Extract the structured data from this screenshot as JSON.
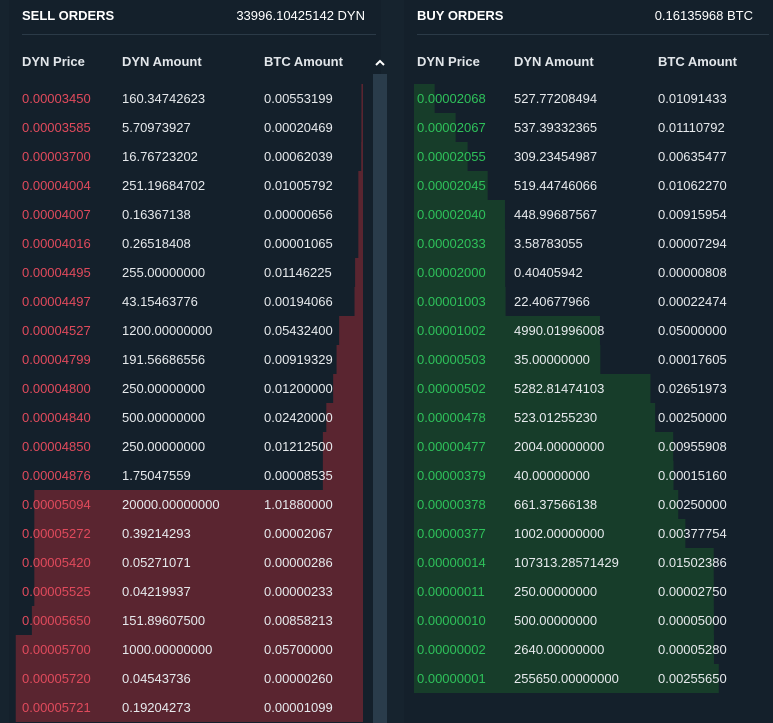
{
  "colors": {
    "sell_price": "#e04a5c",
    "buy_price": "#2ec15a",
    "sell_depth_fill": "#5a2530",
    "buy_depth_fill": "#173d2a"
  },
  "sell": {
    "title": "SELL ORDERS",
    "total": "33996.10425142 DYN",
    "headers": [
      "DYN Price",
      "DYN Amount",
      "BTC Amount"
    ],
    "scroll_icon": "chevron-up-icon",
    "rows": [
      {
        "price": "0.00003450",
        "dyn": "160.34742623",
        "btc": "0.00553199"
      },
      {
        "price": "0.00003585",
        "dyn": "5.70973927",
        "btc": "0.00020469"
      },
      {
        "price": "0.00003700",
        "dyn": "16.76723202",
        "btc": "0.00062039"
      },
      {
        "price": "0.00004004",
        "dyn": "251.19684702",
        "btc": "0.01005792"
      },
      {
        "price": "0.00004007",
        "dyn": "0.16367138",
        "btc": "0.00000656"
      },
      {
        "price": "0.00004016",
        "dyn": "0.26518408",
        "btc": "0.00001065"
      },
      {
        "price": "0.00004495",
        "dyn": "255.00000000",
        "btc": "0.01146225"
      },
      {
        "price": "0.00004497",
        "dyn": "43.15463776",
        "btc": "0.00194066"
      },
      {
        "price": "0.00004527",
        "dyn": "1200.00000000",
        "btc": "0.05432400"
      },
      {
        "price": "0.00004799",
        "dyn": "191.56686556",
        "btc": "0.00919329"
      },
      {
        "price": "0.00004800",
        "dyn": "250.00000000",
        "btc": "0.01200000"
      },
      {
        "price": "0.00004840",
        "dyn": "500.00000000",
        "btc": "0.02420000"
      },
      {
        "price": "0.00004850",
        "dyn": "250.00000000",
        "btc": "0.01212500"
      },
      {
        "price": "0.00004876",
        "dyn": "1.75047559",
        "btc": "0.00008535"
      },
      {
        "price": "0.00005094",
        "dyn": "20000.00000000",
        "btc": "1.01880000"
      },
      {
        "price": "0.00005272",
        "dyn": "0.39214293",
        "btc": "0.00002067"
      },
      {
        "price": "0.00005420",
        "dyn": "0.05271071",
        "btc": "0.00000286"
      },
      {
        "price": "0.00005525",
        "dyn": "0.04219937",
        "btc": "0.00000233"
      },
      {
        "price": "0.00005650",
        "dyn": "151.89607500",
        "btc": "0.00858213"
      },
      {
        "price": "0.00005700",
        "dyn": "1000.00000000",
        "btc": "0.05700000"
      },
      {
        "price": "0.00005720",
        "dyn": "0.04543736",
        "btc": "0.00000260"
      },
      {
        "price": "0.00005721",
        "dyn": "0.19204273",
        "btc": "0.00001099"
      }
    ]
  },
  "buy": {
    "title": "BUY ORDERS",
    "total": "0.16135968 BTC",
    "headers": [
      "DYN Price",
      "DYN Amount",
      "BTC Amount"
    ],
    "rows": [
      {
        "price": "0.00002068",
        "dyn": "527.77208494",
        "btc": "0.01091433"
      },
      {
        "price": "0.00002067",
        "dyn": "537.39332365",
        "btc": "0.01110792"
      },
      {
        "price": "0.00002055",
        "dyn": "309.23454987",
        "btc": "0.00635477"
      },
      {
        "price": "0.00002045",
        "dyn": "519.44746066",
        "btc": "0.01062270"
      },
      {
        "price": "0.00002040",
        "dyn": "448.99687567",
        "btc": "0.00915954"
      },
      {
        "price": "0.00002033",
        "dyn": "3.58783055",
        "btc": "0.00007294"
      },
      {
        "price": "0.00002000",
        "dyn": "0.40405942",
        "btc": "0.00000808"
      },
      {
        "price": "0.00001003",
        "dyn": "22.40677966",
        "btc": "0.00022474"
      },
      {
        "price": "0.00001002",
        "dyn": "4990.01996008",
        "btc": "0.05000000"
      },
      {
        "price": "0.00000503",
        "dyn": "35.00000000",
        "btc": "0.00017605"
      },
      {
        "price": "0.00000502",
        "dyn": "5282.81474103",
        "btc": "0.02651973"
      },
      {
        "price": "0.00000478",
        "dyn": "523.01255230",
        "btc": "0.00250000"
      },
      {
        "price": "0.00000477",
        "dyn": "2004.00000000",
        "btc": "0.00955908"
      },
      {
        "price": "0.00000379",
        "dyn": "40.00000000",
        "btc": "0.00015160"
      },
      {
        "price": "0.00000378",
        "dyn": "661.37566138",
        "btc": "0.00250000"
      },
      {
        "price": "0.00000377",
        "dyn": "1002.00000000",
        "btc": "0.00377754"
      },
      {
        "price": "0.00000014",
        "dyn": "107313.28571429",
        "btc": "0.01502386"
      },
      {
        "price": "0.00000011",
        "dyn": "250.00000000",
        "btc": "0.00002750"
      },
      {
        "price": "0.00000010",
        "dyn": "500.00000000",
        "btc": "0.00005000"
      },
      {
        "price": "0.00000002",
        "dyn": "2640.00000000",
        "btc": "0.00005280"
      },
      {
        "price": "0.00000001",
        "dyn": "255650.00000000",
        "btc": "0.00255650"
      }
    ]
  }
}
